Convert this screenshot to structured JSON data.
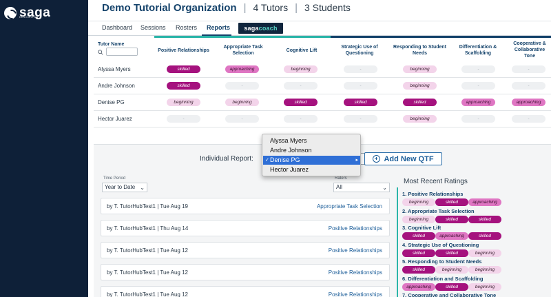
{
  "brand": {
    "name": "saga",
    "sub": "EDUCATION"
  },
  "header": {
    "org": "Demo Tutorial Organization",
    "tutors": "4 Tutors",
    "students": "3 Students",
    "sep": "|"
  },
  "tabs": [
    {
      "label": "Dashboard"
    },
    {
      "label": "Sessions"
    },
    {
      "label": "Rosters"
    },
    {
      "label": "Reports"
    }
  ],
  "coach_badge": {
    "a": "saga",
    "b": "coach"
  },
  "table": {
    "tutor_header": "Tutor Name",
    "columns": [
      "Positive Relationships",
      "Appropriate Task Selection",
      "Cognitive Lift",
      "Strategic Use of Questioning",
      "Responding to Student Needs",
      "Differentiation & Scaffolding",
      "Cooperative & Collaborative Tone"
    ],
    "rows": [
      {
        "name": "Alyssa Myers",
        "ratings": [
          "skilled",
          "approaching",
          "beginning",
          "-",
          "beginning",
          "-",
          "-"
        ]
      },
      {
        "name": "Andre Johnson",
        "ratings": [
          "skilled",
          "-",
          "-",
          "-",
          "beginning",
          "-",
          "-"
        ]
      },
      {
        "name": "Denise PG",
        "ratings": [
          "beginning",
          "beginning",
          "skilled",
          "skilled",
          "skilled",
          "approaching",
          "approaching"
        ]
      },
      {
        "name": "Hector Juarez",
        "ratings": [
          "-",
          "-",
          "-",
          "-",
          "beginning",
          "-",
          "-"
        ]
      }
    ]
  },
  "report": {
    "label": "Individual Report:",
    "add_button": "Add New QTF",
    "time_period_label": "Time Period",
    "time_period_value": "Year to Date",
    "raters_label": "Raters",
    "raters_value": "All",
    "qtfs": [
      {
        "by": "by T. TutorHubTest1  |  Tue Aug 19",
        "skill": "Appropriate Task Selection"
      },
      {
        "by": "by T. TutorHubTest1  |  Thu Aug 14",
        "skill": "Positive Relationships"
      },
      {
        "by": "by T. TutorHubTest1  |  Tue Aug 12",
        "skill": "Positive Relationships"
      },
      {
        "by": "by T. TutorHubTest1  |  Tue Aug 12",
        "skill": "Positive Relationships"
      },
      {
        "by": "by T. TutorHubTest1  |  Tue Aug 12",
        "skill": "Positive Relationships"
      }
    ],
    "recent_title": "Most Recent Ratings",
    "recent": [
      {
        "name": "1. Positive Relationships",
        "ratings": [
          "beginning",
          "skilled",
          "approaching"
        ]
      },
      {
        "name": "2. Appropriate Task Selection",
        "ratings": [
          "beginning",
          "skilled",
          "skilled"
        ]
      },
      {
        "name": "3. Cognitive Lift",
        "ratings": [
          "skilled",
          "approaching",
          "skilled"
        ]
      },
      {
        "name": "4. Strategic Use of Questioning",
        "ratings": [
          "skilled",
          "skilled",
          "beginning"
        ]
      },
      {
        "name": "5. Responding to Student Needs",
        "ratings": [
          "skilled",
          "beginning",
          "beginning"
        ]
      },
      {
        "name": "6. Differentiation and Scaffolding",
        "ratings": [
          "approaching",
          "skilled",
          "beginning"
        ]
      },
      {
        "name": "7. Cooperative and Collaborative Tone",
        "ratings": []
      }
    ]
  },
  "dropdown": {
    "options": [
      "Alyssa Myers",
      "Andre Johnson",
      "Denise PG",
      "Hector Juarez"
    ],
    "selected": "Denise PG"
  },
  "colors": {
    "sidebar": "#0e2038",
    "brand_blue": "#15436b",
    "teal": "#2bb5a8",
    "skilled": "#a5127e",
    "approaching": "#df76c3",
    "beginning": "#f3d4ea"
  }
}
